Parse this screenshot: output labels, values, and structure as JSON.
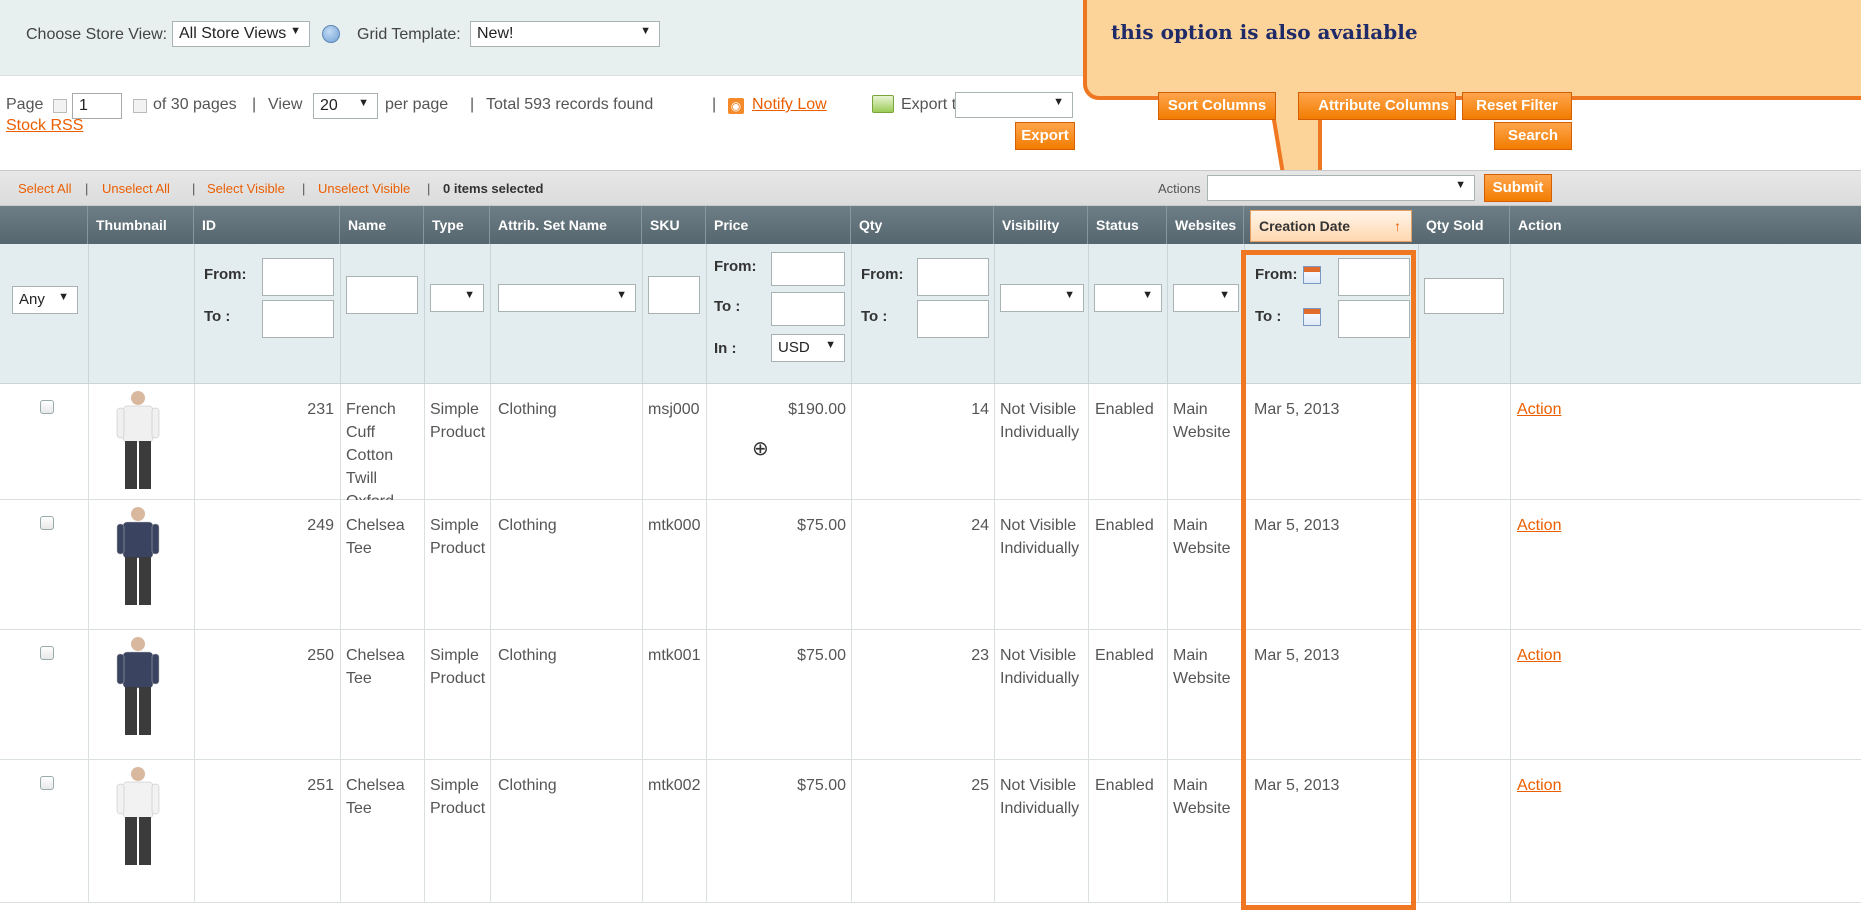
{
  "store": {
    "store_view_label": "Choose Store View:",
    "store_view_value": "All Store Views",
    "grid_template_label": "Grid Template:",
    "grid_template_value": "New!"
  },
  "pager": {
    "page_label": "Page",
    "page_value": "1",
    "of_pages": "of 30 pages",
    "view_label": "View",
    "view_value": "20",
    "per_page": "per page",
    "total": "Total 593 records found",
    "notify_line1": "Notify Low",
    "notify_line2": "Stock RSS",
    "sep": "|"
  },
  "export": {
    "label": "Export to:",
    "button": "Export"
  },
  "buttons": {
    "sort_columns": "Sort Columns",
    "attribute_columns": "Attribute Columns",
    "reset_filter": "Reset Filter",
    "search": "Search",
    "submit": "Submit"
  },
  "massaction": {
    "select_all": "Select All",
    "unselect_all": "Unselect All",
    "select_visible": "Select Visible",
    "unselect_visible": "Unselect Visible",
    "items_selected": "0 items selected",
    "actions_label": "Actions"
  },
  "callout": {
    "text": "this option is also available"
  },
  "columns": [
    "Thumbnail",
    "ID",
    "Name",
    "Type",
    "Attrib. Set Name",
    "SKU",
    "Price",
    "Qty",
    "Visibility",
    "Status",
    "Websites",
    "Creation Date",
    "Qty Sold",
    "Action"
  ],
  "sort_arrow": "↑",
  "filters": {
    "any": "Any",
    "from": "From:",
    "to": "To :",
    "in": "In :",
    "currency": "USD"
  },
  "rows": [
    {
      "id": "231",
      "name": [
        "French",
        "Cuff",
        "Cotton",
        "Twill",
        "Oxford"
      ],
      "type": [
        "Simple",
        "Product"
      ],
      "attrib_set": "Clothing",
      "sku": "msj000",
      "price": "$190.00",
      "qty": "14",
      "visibility": [
        "Not Visible",
        "Individually"
      ],
      "status": "Enabled",
      "websites": [
        "Main",
        "Website"
      ],
      "creation_date": "Mar 5, 2013",
      "action": "Action"
    },
    {
      "id": "249",
      "name": [
        "Chelsea",
        "Tee"
      ],
      "type": [
        "Simple",
        "Product"
      ],
      "attrib_set": "Clothing",
      "sku": "mtk000",
      "price": "$75.00",
      "qty": "24",
      "visibility": [
        "Not Visible",
        "Individually"
      ],
      "status": "Enabled",
      "websites": [
        "Main",
        "Website"
      ],
      "creation_date": "Mar 5, 2013",
      "action": "Action"
    },
    {
      "id": "250",
      "name": [
        "Chelsea",
        "Tee"
      ],
      "type": [
        "Simple",
        "Product"
      ],
      "attrib_set": "Clothing",
      "sku": "mtk001",
      "price": "$75.00",
      "qty": "23",
      "visibility": [
        "Not Visible",
        "Individually"
      ],
      "status": "Enabled",
      "websites": [
        "Main",
        "Website"
      ],
      "creation_date": "Mar 5, 2013",
      "action": "Action"
    },
    {
      "id": "251",
      "name": [
        "Chelsea",
        "Tee"
      ],
      "type": [
        "Simple",
        "Product"
      ],
      "attrib_set": "Clothing",
      "sku": "mtk002",
      "price": "$75.00",
      "qty": "25",
      "visibility": [
        "Not Visible",
        "Individually"
      ],
      "status": "Enabled",
      "websites": [
        "Main",
        "Website"
      ],
      "creation_date": "Mar 5, 2013",
      "action": "Action"
    }
  ]
}
